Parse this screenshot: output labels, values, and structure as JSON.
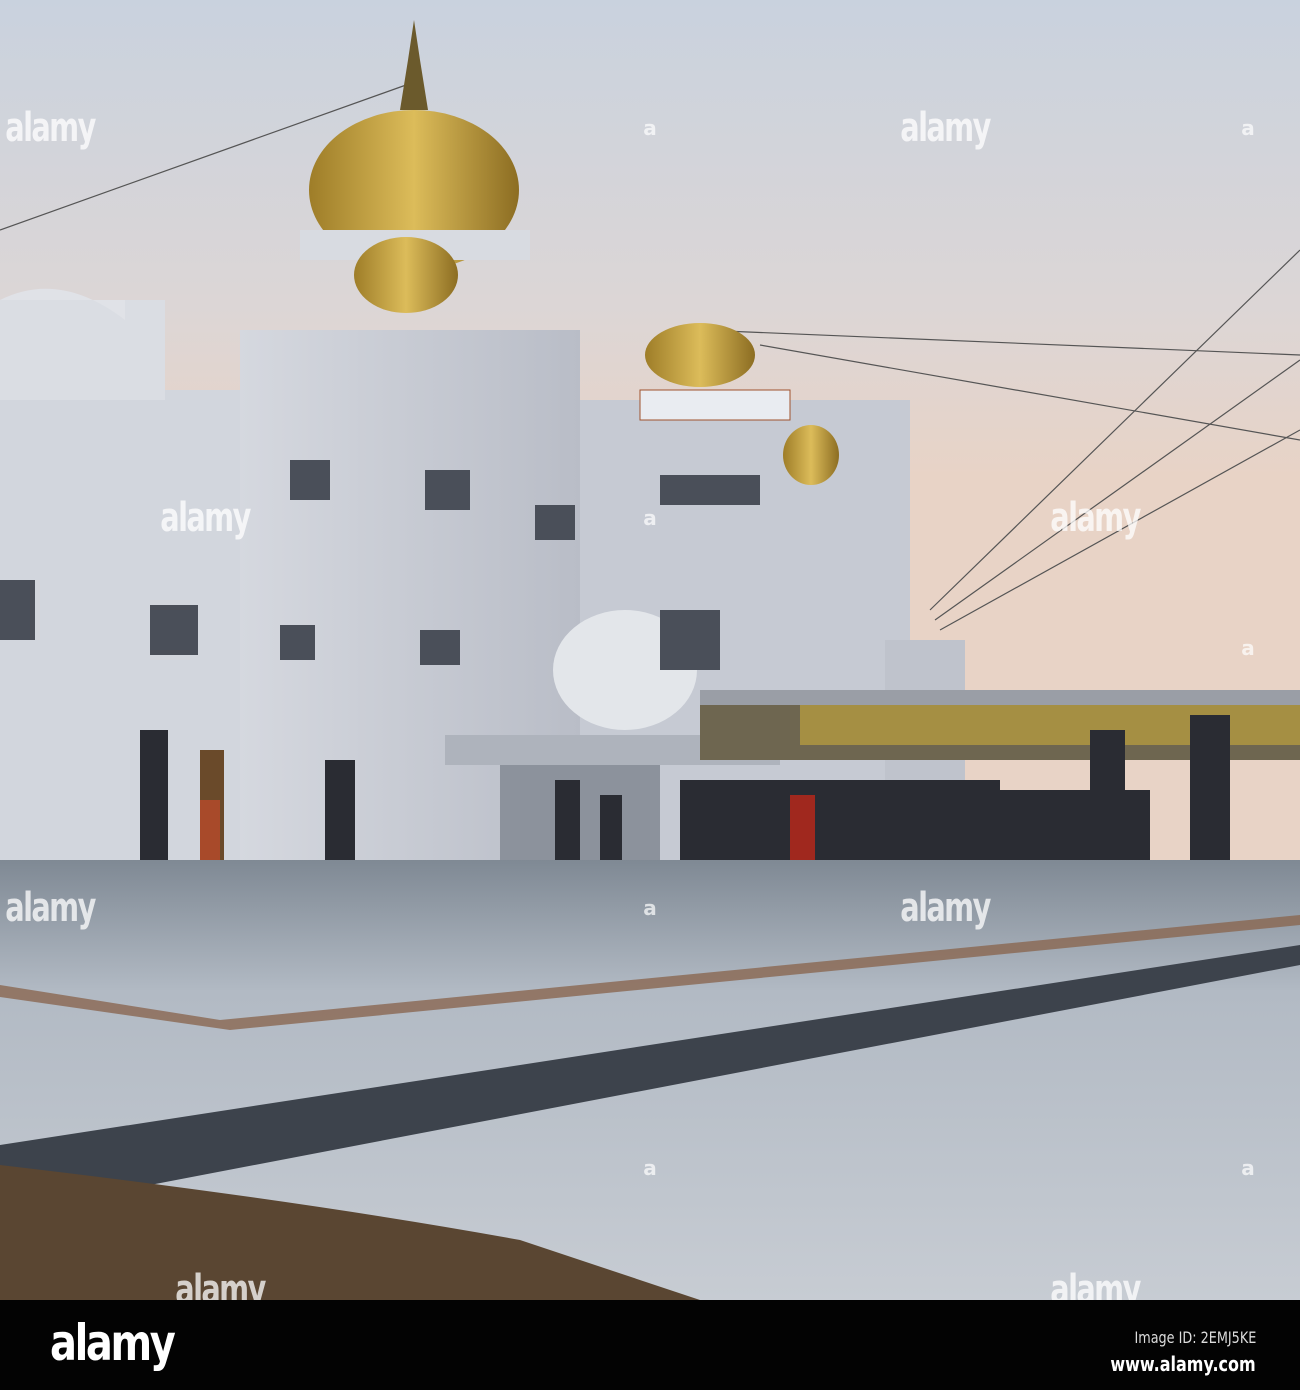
{
  "watermark": {
    "text": "alamy",
    "mark": "a"
  },
  "footer": {
    "logo": "alamy",
    "image_id": "Image ID: 2EMJ5KE",
    "website": "www.alamy.com"
  },
  "colors": {
    "sky_top": "#c9d0dc",
    "sky_bottom": "#e7d2c4",
    "gold": "#c9a645",
    "marble": "#dcdfe6",
    "floor": "#9aa3ad"
  }
}
